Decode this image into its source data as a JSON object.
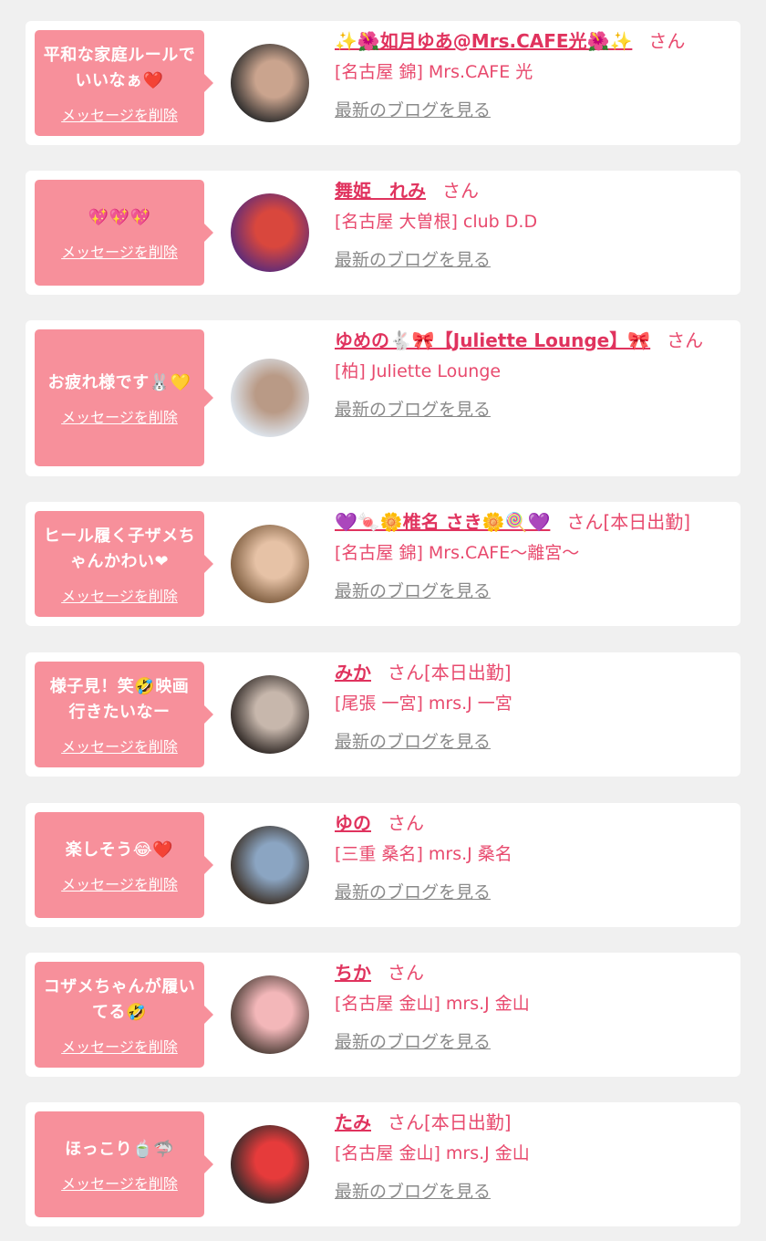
{
  "entries": [
    {
      "message": "平和な家庭ルールでいいなぁ❤️",
      "delete_label": "メッセージを削除",
      "name": "✨🌺如月ゆあ@Mrs.CAFE光🌺✨",
      "suffix": "さん",
      "shop": "[名古屋 錦] Mrs.CAFE 光",
      "blog_label": "最新のブログを見る",
      "avatar_colors": [
        "#2a2a2a",
        "#caa48e"
      ]
    },
    {
      "message": "💖💖💖",
      "delete_label": "メッセージを削除",
      "name": "舞姫　れみ",
      "suffix": "さん",
      "shop": "[名古屋 大曽根] club D.D",
      "blog_label": "最新のブログを見る",
      "avatar_colors": [
        "#5b2b7a",
        "#d9473d"
      ]
    },
    {
      "message": "お疲れ様です🐰💛",
      "delete_label": "メッセージを削除",
      "name": "ゆめの🐇🎀【Juliette Lounge】🎀",
      "suffix": "さん",
      "shop": "[柏] Juliette Lounge",
      "blog_label": "最新のブログを見る",
      "avatar_colors": [
        "#dfe9f3",
        "#b99a86"
      ]
    },
    {
      "message": "ヒール履く子ザメちゃんかわい❤",
      "delete_label": "メッセージを削除",
      "name": "💜🍬🌼椎名 さき🌼🍭💜",
      "suffix": "さん[本日出勤]",
      "shop": "[名古屋 錦] Mrs.CAFE〜離宮〜",
      "blog_label": "最新のブログを見る",
      "avatar_colors": [
        "#7b5a3c",
        "#e6c2a6"
      ]
    },
    {
      "message": "様子見！笑🤣映画行きたいなー",
      "delete_label": "メッセージを削除",
      "name": "みか",
      "suffix": "さん[本日出勤]",
      "shop": "[尾張 一宮] mrs.J 一宮",
      "blog_label": "最新のブログを見る",
      "avatar_colors": [
        "#2c2522",
        "#c7b7ac"
      ]
    },
    {
      "message": "楽しそう😂❤️",
      "delete_label": "メッセージを削除",
      "name": "ゆの",
      "suffix": "さん",
      "shop": "[三重 桑名] mrs.J 桑名",
      "blog_label": "最新のブログを見る",
      "avatar_colors": [
        "#3a2e24",
        "#8ba5c2"
      ]
    },
    {
      "message": "コザメちゃんが履いてる🤣",
      "delete_label": "メッセージを削除",
      "name": "ちか",
      "suffix": "さん",
      "shop": "[名古屋 金山] mrs.J 金山",
      "blog_label": "最新のブログを見る",
      "avatar_colors": [
        "#4a3c35",
        "#f3b7b9"
      ]
    },
    {
      "message": "ほっこり🍵🦈",
      "delete_label": "メッセージを削除",
      "name": "たみ",
      "suffix": "さん[本日出勤]",
      "shop": "[名古屋 金山] mrs.J 金山",
      "blog_label": "最新のブログを見る",
      "avatar_colors": [
        "#2b2b2b",
        "#e63b3b"
      ]
    }
  ]
}
